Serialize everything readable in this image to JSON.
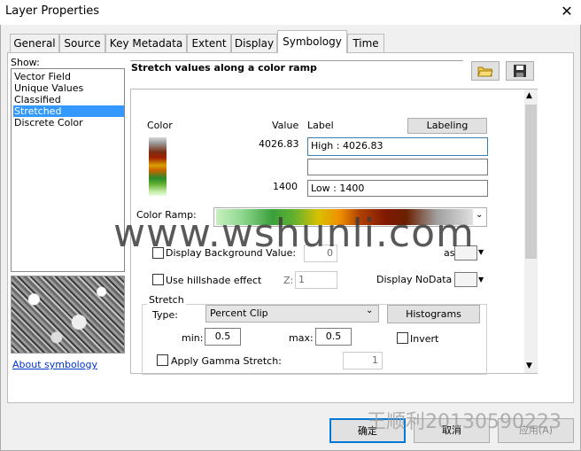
{
  "window": {
    "title": "Layer Properties",
    "close": "✕"
  },
  "tabs": [
    "General",
    "Source",
    "Key Metadata",
    "Extent",
    "Display",
    "Symbology",
    "Time"
  ],
  "show": {
    "label": "Show:",
    "items": [
      "Vector Field",
      "Unique Values",
      "Classified",
      "Stretched",
      "Discrete Color"
    ],
    "selected": "Stretched"
  },
  "about_link": "About symbology",
  "panel": {
    "heading": "Stretch values along a color ramp",
    "columns": {
      "color": "Color",
      "value": "Value",
      "label": "Label"
    },
    "labeling_button": "Labeling",
    "high_value": "4026.83",
    "low_value": "1400",
    "high_label": "High : 4026.83",
    "mid_label": "",
    "low_label": "Low : 1400",
    "color_ramp_label": "Color Ramp:",
    "display_background": {
      "label": "Display Background Value:",
      "value": "0",
      "checked": false
    },
    "as_label": "as",
    "hillshade": {
      "label": "Use hillshade effect",
      "z_label": "Z:",
      "z_value": "1",
      "checked": false
    },
    "nodata_label": "Display NoData as",
    "stretch": {
      "group": "Stretch",
      "type_label": "Type:",
      "type_value": "Percent Clip",
      "histograms_button": "Histograms",
      "min_label": "min:",
      "min_value": "0.5",
      "max_label": "max:",
      "max_value": "0.5",
      "invert_label": "Invert",
      "gamma_label": "Apply Gamma Stretch:",
      "gamma_value": "1"
    }
  },
  "footer": {
    "ok": "确定",
    "cancel": "取消",
    "apply": "应用(A)"
  },
  "watermarks": {
    "main": "www.wshunli.com",
    "corner": "王顺利20130590223"
  },
  "icons": {
    "open": "open-folder-icon",
    "save": "save-icon"
  }
}
